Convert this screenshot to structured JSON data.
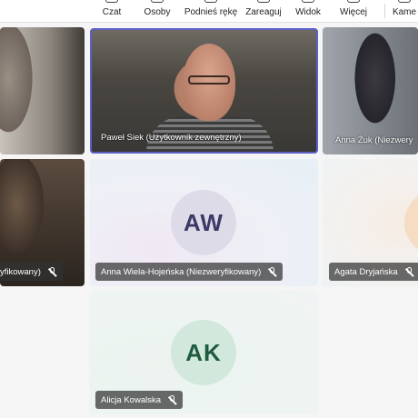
{
  "toolbar": {
    "items": [
      {
        "label": "Czat",
        "icon": "chat-icon"
      },
      {
        "label": "Osoby",
        "icon": "people-icon"
      },
      {
        "label": "Podnieś rękę",
        "icon": "raise-hand-icon"
      },
      {
        "label": "Zareaguj",
        "icon": "react-icon"
      },
      {
        "label": "Widok",
        "icon": "view-icon"
      },
      {
        "label": "Więcej",
        "icon": "more-icon"
      },
      {
        "label": "Kame",
        "icon": "camera-icon"
      }
    ]
  },
  "participants": [
    {
      "name": "",
      "type": "video"
    },
    {
      "name": "Paweł Siek (Użytkownik zewnętrzny)",
      "type": "video",
      "active": true
    },
    {
      "name": "Anna Żuk (Niezwery",
      "type": "video"
    },
    {
      "name": "yfikowany)",
      "type": "video",
      "muted": true
    },
    {
      "name": "Anna Wiela-Hojeńska (Niezweryfikowany)",
      "initials": "AW",
      "type": "avatar",
      "muted": true
    },
    {
      "name": "Agata Dryjańska",
      "type": "avatar",
      "muted": true
    },
    {
      "name": "Alicja Kowalska",
      "initials": "AK",
      "type": "avatar",
      "muted": true
    }
  ],
  "colors": {
    "active_border": "#5b5fc7",
    "aw_avatar": "#dedbe9",
    "ak_avatar": "#d2e8dc"
  }
}
